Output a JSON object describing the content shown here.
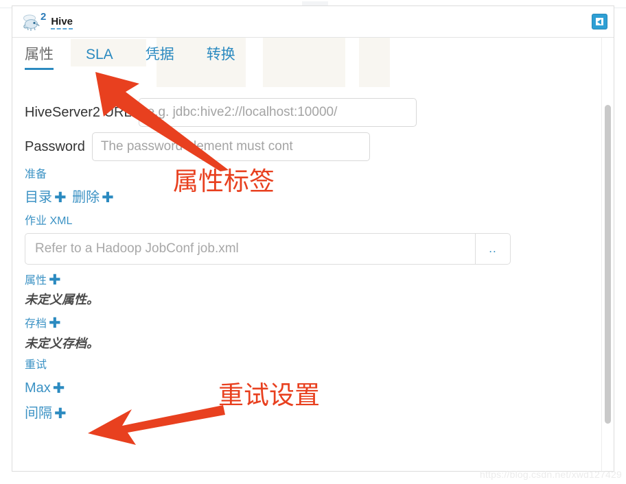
{
  "window": {
    "brand_superscript": "2",
    "brand_name": "Hive",
    "collapse_button_title": "collapse-panel"
  },
  "tabs": [
    {
      "label": "属性",
      "active": true
    },
    {
      "label": "SLA",
      "active": false
    },
    {
      "label": "凭据",
      "active": false
    },
    {
      "label": "转换",
      "active": false
    }
  ],
  "form": {
    "hiveserver2_url": {
      "label": "HiveServer2 URL",
      "value": "",
      "placeholder": "e.g. jdbc:hive2://localhost:10000/"
    },
    "password": {
      "label": "Password",
      "value": "",
      "placeholder": "The password element must cont"
    }
  },
  "sections": {
    "prepare": {
      "title": "准备",
      "mkdir_label": "目录",
      "mkdir_plus": "✚",
      "delete_label": "删除",
      "delete_plus": "✚"
    },
    "job_xml": {
      "title": "作业 XML",
      "input_value": "",
      "input_placeholder": "Refer to a Hadoop JobConf job.xml",
      "browse_label": ".."
    },
    "properties": {
      "title": "属性",
      "plus": "✚",
      "empty_text": "未定义属性。"
    },
    "archives": {
      "title": "存档",
      "plus": "✚",
      "empty_text": "未定义存档。"
    },
    "retry": {
      "title": "重试",
      "max_label": "Max",
      "max_plus": "✚",
      "interval_label": "间隔",
      "interval_plus": "✚"
    }
  },
  "annotations": [
    {
      "id": "anno-1",
      "text": "属性标签",
      "color": "#e8401f"
    },
    {
      "id": "anno-2",
      "text": "重试设置",
      "color": "#e8401f"
    }
  ],
  "watermark": "https://blog.csdn.net/xwd127429",
  "colors": {
    "link_blue": "#3b92c4",
    "tab_active_underline": "#2b8ac0",
    "annotation_red": "#e8401f",
    "collapse_button": "#2e9fd4"
  }
}
